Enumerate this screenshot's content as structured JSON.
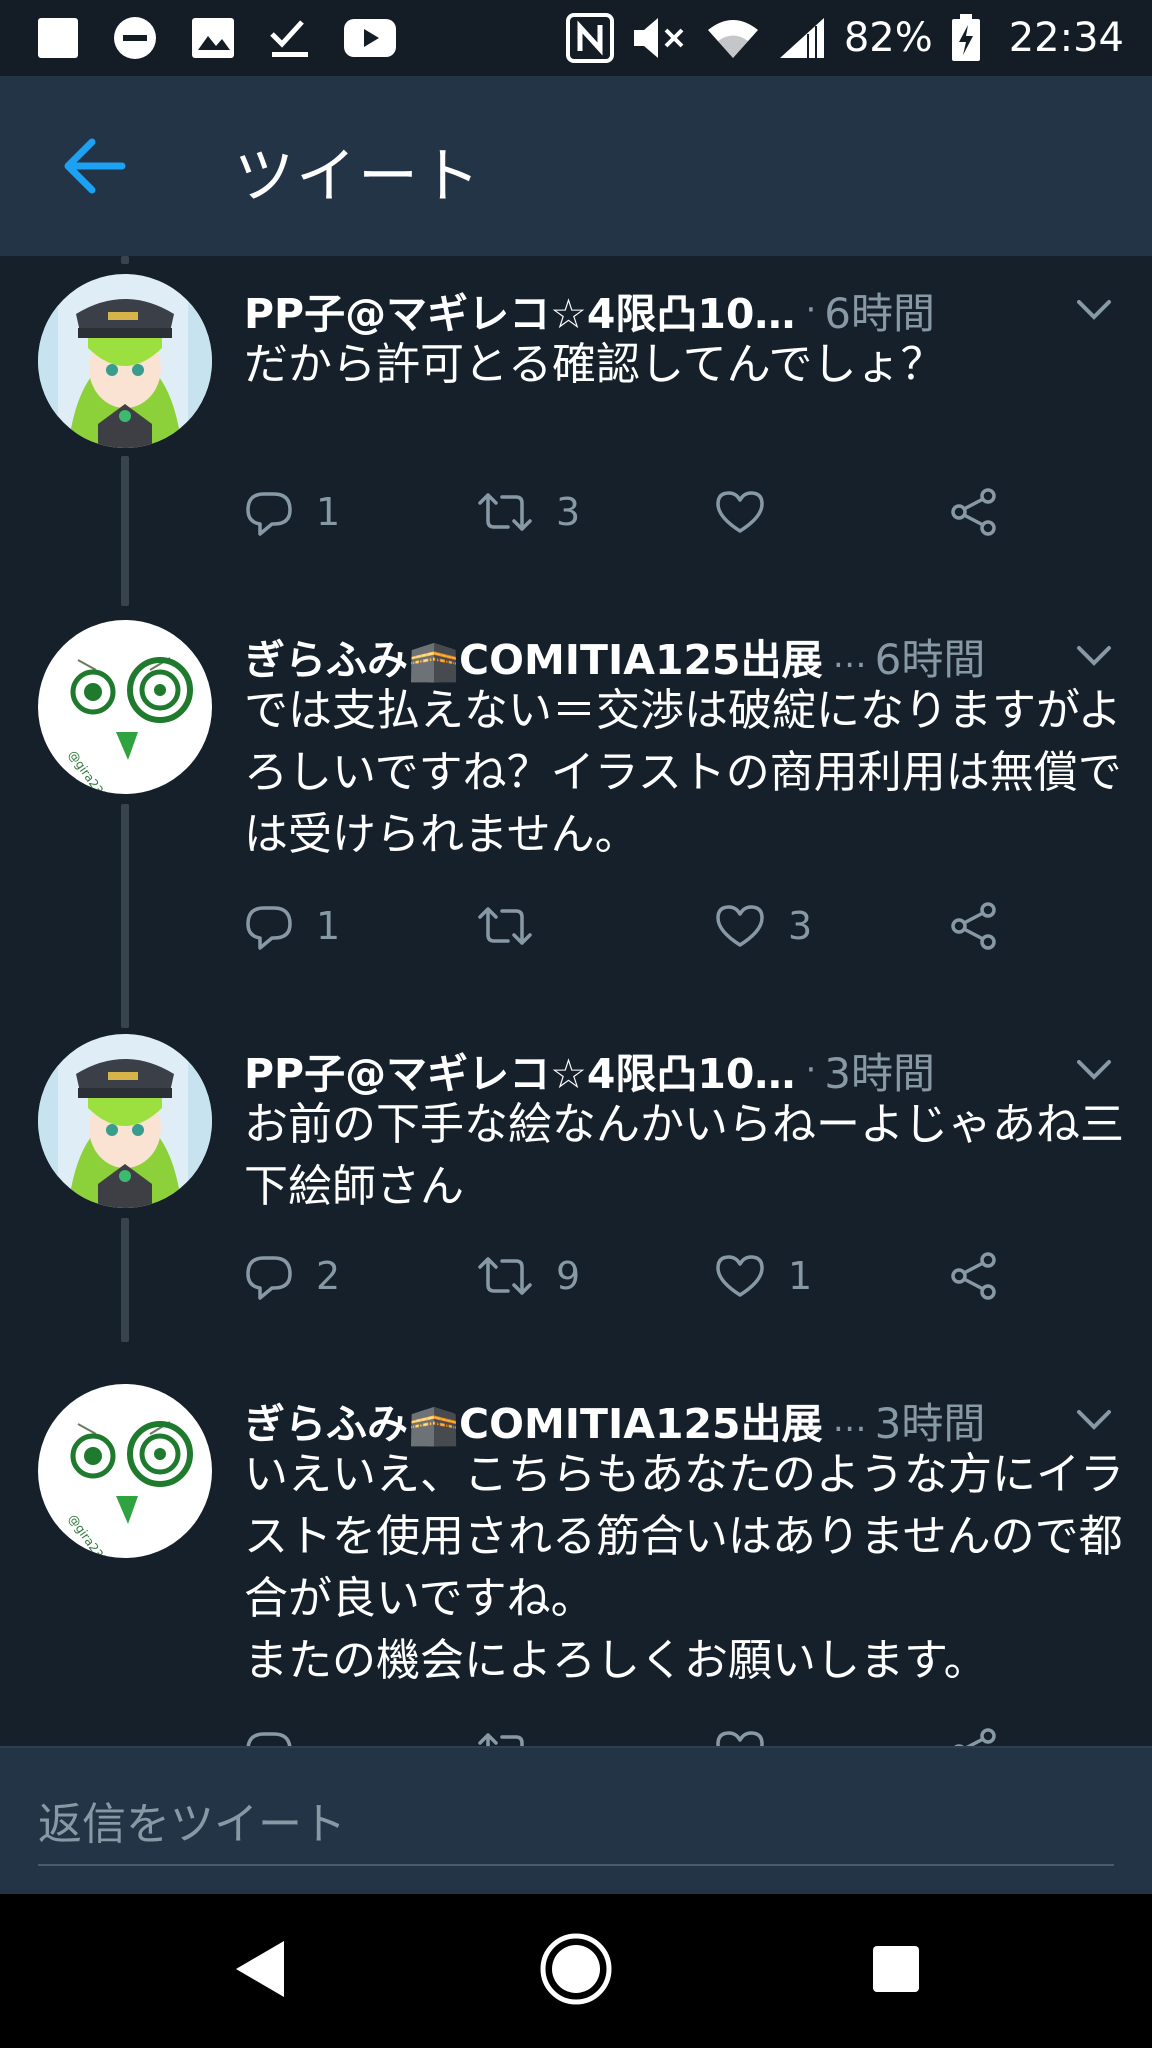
{
  "status_bar": {
    "battery": "82%",
    "time": "22:34",
    "icons": [
      "stop-icon",
      "do-not-disturb-icon",
      "image-icon",
      "checkmark-icon",
      "youtube-icon",
      "nfc-icon",
      "mute-icon",
      "wifi-icon",
      "signal-icon",
      "battery-charging-icon"
    ]
  },
  "header": {
    "title": "ツイート",
    "back_icon": "arrow-left-icon",
    "accent_color": "#1da1f2"
  },
  "tweets": [
    {
      "name": "PP子@マギレコ☆4限凸10…",
      "dots": "·",
      "time": "6時間",
      "text": "だから許可とる確認してんでしょ？",
      "replies": "1",
      "retweets": "3",
      "likes": ""
    },
    {
      "name": "ぎらふみ🕋COMITIA125出展",
      "dots": "…",
      "time": "6時間",
      "text": "では支払えない＝交渉は破綻になりますがよろしいですね？イラストの商用利用は無償では受けられません。",
      "replies": "1",
      "retweets": "",
      "likes": "3"
    },
    {
      "name": "PP子@マギレコ☆4限凸10…",
      "dots": "·",
      "time": "3時間",
      "text": "お前の下手な絵なんかいらねーよじゃあね三下絵師さん",
      "replies": "2",
      "retweets": "9",
      "likes": "1"
    },
    {
      "name": "ぎらふみ🕋COMITIA125出展",
      "dots": "…",
      "time": "3時間",
      "text": "いえいえ、こちらもあなたのような方にイラストを使用される筋合いはありませんので都合が良いですね。\nまたの機会によろしくお願いします。",
      "replies": "",
      "retweets": "",
      "likes": ""
    }
  ],
  "reply_bar": {
    "placeholder": "返信をツイート"
  },
  "nav_bar": {
    "icons": [
      "back-triangle-icon",
      "home-circle-icon",
      "recents-square-icon"
    ]
  }
}
